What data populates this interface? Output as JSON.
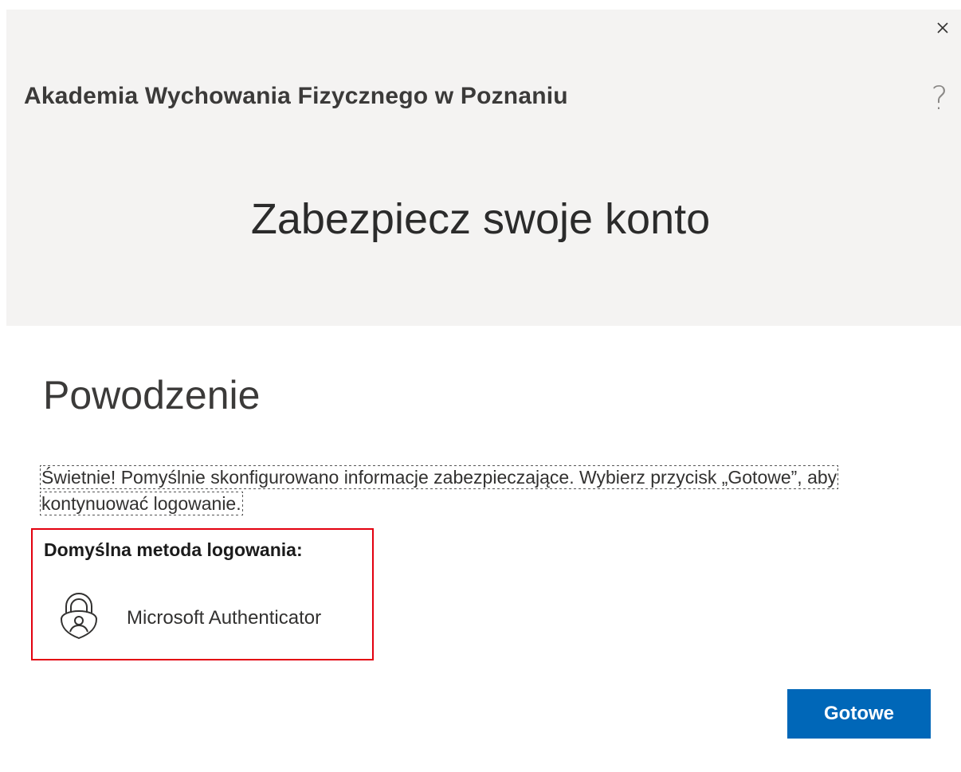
{
  "header": {
    "organization": "Akademia Wychowania Fizycznego w Poznaniu",
    "page_title": "Zabezpiecz swoje konto",
    "help_label": "?",
    "close_icon": "close-icon"
  },
  "main": {
    "section_title": "Powodzenie",
    "message": "Świetnie! Pomyślnie skonfigurowano informacje zabezpieczające. Wybierz przycisk „Gotowe”, aby kontynuować logowanie.",
    "default_method_label": "Domyślna metoda logowania:",
    "default_method_name": "Microsoft Authenticator",
    "default_method_icon": "authenticator-lock-icon",
    "highlight_color": "#e3000f"
  },
  "actions": {
    "done_label": "Gotowe",
    "done_color": "#0067b8"
  }
}
